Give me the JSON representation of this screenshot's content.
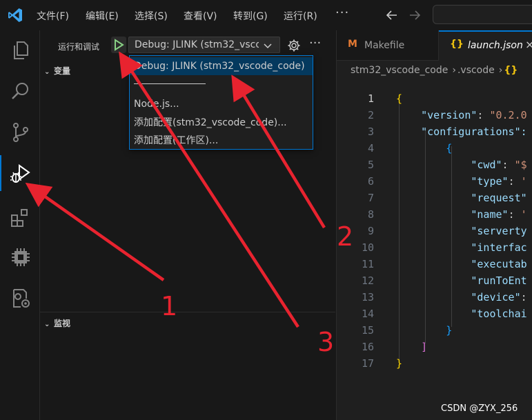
{
  "menu": {
    "items": [
      "文件(F)",
      "编辑(E)",
      "选择(S)",
      "查看(V)",
      "转到(G)",
      "运行(R)"
    ],
    "more": "···"
  },
  "activity_bar": {
    "icons": [
      "explorer-icon",
      "search-icon",
      "source-control-icon",
      "run-debug-icon",
      "extensions-icon",
      "chip-icon",
      "remote-explorer-icon"
    ],
    "active": "run-debug-icon"
  },
  "sidebar": {
    "title": "运行和调试",
    "config_select": "Debug: JLINK (stm32_vscode_code)",
    "more": "···",
    "sections": {
      "variables": "变量",
      "watch": "监视"
    }
  },
  "dropdown": {
    "items": [
      "Debug: JLINK (stm32_vscode_code)",
      "Node.js...",
      "添加配置(stm32_vscode_code)...",
      "添加配置(工作区)..."
    ],
    "selected_index": 0
  },
  "editor": {
    "tabs": [
      {
        "icon": "M",
        "label": "Makefile",
        "icon_color": "#e37933"
      },
      {
        "icon": "{}",
        "label": "launch.json",
        "close": "×"
      }
    ],
    "breadcrumb": [
      "stm32_vscode_code",
      ".vscode",
      "{}"
    ],
    "line_numbers": [
      "1",
      "2",
      "3",
      "4",
      "5",
      "6",
      "7",
      "8",
      "9",
      "10",
      "11",
      "12",
      "13",
      "14",
      "15",
      "16",
      "17"
    ],
    "code": {
      "version_key": "\"version\"",
      "version_val": "\"0.2.0",
      "configurations_key": "\"configurations\":",
      "cwd_key": "\"cwd\"",
      "cwd_val": "\"$",
      "type_key": "\"type\"",
      "type_val": "'",
      "request_key": "\"request\"",
      "name_key": "\"name\"",
      "name_val": "'",
      "servertype_key": "\"serverty",
      "interface_key": "\"interfac",
      "executable_key": "\"executab",
      "runtoentry_key": "\"runToEnt",
      "device_key": "\"device\"",
      "toolchain_key": "\"toolchai"
    }
  },
  "annotations": [
    "1",
    "2",
    "3"
  ],
  "watermark": "CSDN @ZYX_256",
  "colors": {
    "accent": "#0078d4",
    "arrow": "#e8232f",
    "run_green": "#89d185"
  }
}
